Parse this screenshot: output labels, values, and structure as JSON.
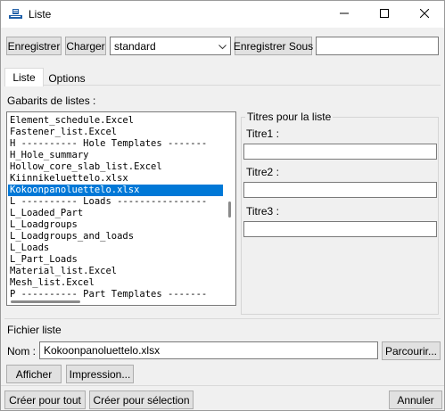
{
  "window": {
    "title": "Liste",
    "minimize_icon": "minimize-icon",
    "maximize_icon": "maximize-icon",
    "close_icon": "close-icon"
  },
  "toolbar": {
    "save": "Enregistrer",
    "load": "Charger",
    "preset": "standard",
    "save_as": "Enregistrer Sous",
    "save_as_name": ""
  },
  "tabs": [
    {
      "label": "Liste",
      "active": true
    },
    {
      "label": "Options",
      "active": false
    }
  ],
  "templates": {
    "label": "Gabarits de listes :",
    "items": [
      "Element_schedule.Excel",
      "Fastener_list.Excel",
      "H ---------- Hole Templates -------",
      "H_Hole_summary",
      "Hollow_core_slab_list.Excel",
      "Kiinnikeluettelo.xlsx",
      "Kokoonpanoluettelo.xlsx",
      "L ---------- Loads ----------------",
      "L_Loaded_Part",
      "L_Loadgroups",
      "L_Loadgroups_and_loads",
      "L_Loads",
      "L_Part_Loads",
      "Material_list.Excel",
      "Mesh_list.Excel",
      "P ---------- Part Templates -------"
    ],
    "selected_index": 6
  },
  "titles": {
    "group_label": "Titres pour la liste",
    "t1": "Titre1 :",
    "t2": "Titre2 :",
    "t3": "Titre3 :",
    "v1": "",
    "v2": "",
    "v3": ""
  },
  "file": {
    "section": "Fichier liste",
    "name_label": "Nom :",
    "name_value": "Kokoonpanoluettelo.xlsx",
    "browse": "Parcourir...",
    "show": "Afficher",
    "print": "Impression..."
  },
  "footer": {
    "create_all": "Créer pour tout",
    "create_selection": "Créer pour sélection",
    "cancel": "Annuler"
  },
  "colors": {
    "selection": "#0078d7",
    "window_bg": "#f0f0f0"
  }
}
